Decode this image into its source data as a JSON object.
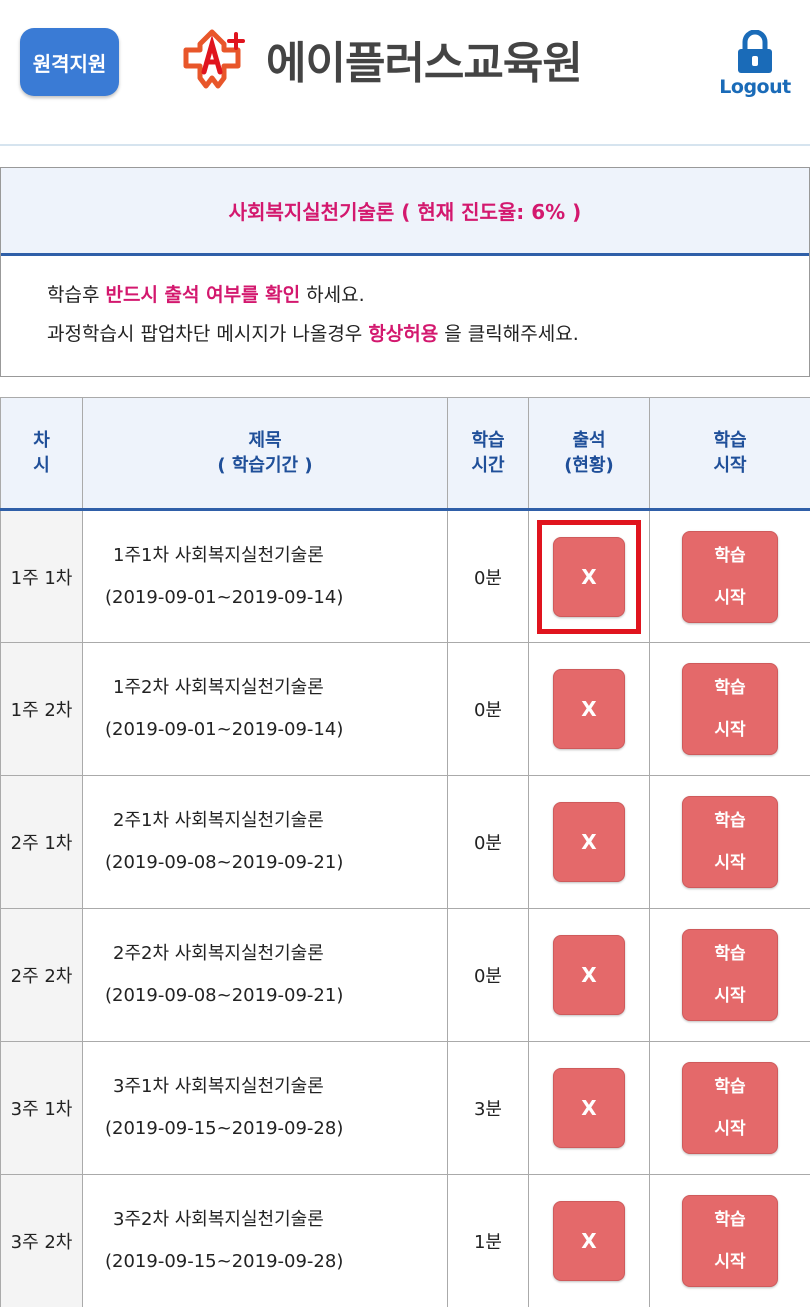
{
  "header": {
    "remote_support_label": "원격지원",
    "logo_text": "에이플러스교육원",
    "logout_label": "Logout"
  },
  "course": {
    "title": "사회복지실천기술론 ( 현재 진도율: 6% )",
    "notice_line1": {
      "before": "학습후 ",
      "highlight": "반드시 출석 여부를 확인",
      "after": " 하세요."
    },
    "notice_line2": {
      "before": "과정학습시 팝업차단 메시지가 나올경우 ",
      "highlight": "항상허용",
      "after": " 을 클릭해주세요."
    }
  },
  "table": {
    "headers": {
      "chasi": [
        "차",
        "시"
      ],
      "title": [
        "제목",
        "( 학습기간 )"
      ],
      "time": [
        "학습",
        "시간"
      ],
      "attendance": [
        "출석",
        "(현황)"
      ],
      "start": [
        "학습",
        "시작"
      ]
    },
    "rows": [
      {
        "chasi": "1주 1차",
        "title": "1주1차 사회복지실천기술론",
        "period": "(2019-09-01~2019-09-14)",
        "time": "0분",
        "attendance": "X",
        "start": [
          "학습",
          "시작"
        ]
      },
      {
        "chasi": "1주 2차",
        "title": "1주2차 사회복지실천기술론",
        "period": "(2019-09-01~2019-09-14)",
        "time": "0분",
        "attendance": "X",
        "start": [
          "학습",
          "시작"
        ]
      },
      {
        "chasi": "2주 1차",
        "title": "2주1차 사회복지실천기술론",
        "period": "(2019-09-08~2019-09-21)",
        "time": "0분",
        "attendance": "X",
        "start": [
          "학습",
          "시작"
        ]
      },
      {
        "chasi": "2주 2차",
        "title": "2주2차 사회복지실천기술론",
        "period": "(2019-09-08~2019-09-21)",
        "time": "0분",
        "attendance": "X",
        "start": [
          "학습",
          "시작"
        ]
      },
      {
        "chasi": "3주 1차",
        "title": "3주1차 사회복지실천기술론",
        "period": "(2019-09-15~2019-09-28)",
        "time": "3분",
        "attendance": "X",
        "start": [
          "학습",
          "시작"
        ]
      },
      {
        "chasi": "3주 2차",
        "title": "3주2차 사회복지실천기술론",
        "period": "(2019-09-15~2019-09-28)",
        "time": "1분",
        "attendance": "X",
        "start": [
          "학습",
          "시작"
        ]
      }
    ]
  },
  "colors": {
    "accent_blue": "#2f5fa8",
    "highlight_pink": "#d3186e",
    "button_red": "#e4696a",
    "selection_frame": "#e0141e"
  },
  "icons": {
    "logout": "lock-icon",
    "logo": "aplus-logo-icon"
  }
}
